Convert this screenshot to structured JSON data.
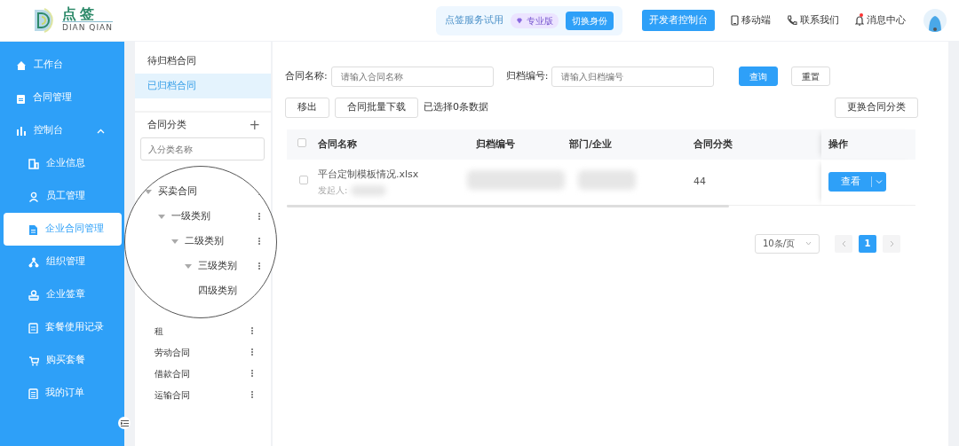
{
  "header": {
    "logo": {
      "title": "点签",
      "subtitle": "DIAN QIAN"
    },
    "trial": {
      "text": "点签服务试用",
      "edition": "专业版",
      "switch_button": "切换身份"
    },
    "dev_button": "开发者控制台",
    "links": [
      {
        "kind": "mobile",
        "label": "移动端"
      },
      {
        "kind": "phone",
        "label": "联系我们"
      },
      {
        "kind": "bell",
        "label": "消息中心",
        "unread": true
      }
    ]
  },
  "sidebar": {
    "items": [
      {
        "kind": "home",
        "label": "工作台",
        "selected": false
      },
      {
        "kind": "clipboard",
        "label": "合同管理",
        "selected": false
      },
      {
        "kind": "chart",
        "label": "控制台",
        "selected": false,
        "expanded": true,
        "children": [
          {
            "kind": "building",
            "label": "企业信息",
            "selected": false
          },
          {
            "kind": "user",
            "label": "员工管理",
            "selected": false
          },
          {
            "kind": "document",
            "label": "企业合同管理",
            "selected": true
          },
          {
            "kind": "org",
            "label": "组织管理",
            "selected": false
          },
          {
            "kind": "stamp",
            "label": "企业签章",
            "selected": false
          },
          {
            "kind": "record",
            "label": "套餐使用记录",
            "selected": false
          },
          {
            "kind": "cart",
            "label": "购买套餐",
            "selected": false
          },
          {
            "kind": "list",
            "label": "我的订单",
            "selected": false
          }
        ]
      }
    ]
  },
  "archive_tabs": [
    {
      "label": "待归档合同",
      "selected": false
    },
    {
      "label": "已归档合同",
      "selected": true
    }
  ],
  "categories": {
    "title": "合同分类",
    "add": "+",
    "search": {
      "placeholder": "入分类名称"
    },
    "tree": [
      {
        "label": "买卖合同",
        "expanded": true,
        "children": [
          {
            "label": "一级类别",
            "expanded": true,
            "children": [
              {
                "label": "二级类别",
                "expanded": true,
                "children": [
                  {
                    "label": "三级类别",
                    "expanded": true,
                    "children": [
                      {
                        "label": "四级类别"
                      }
                    ]
                  }
                ]
              }
            ]
          }
        ]
      },
      {
        "label": "租"
      },
      {
        "label": "劳动合同"
      },
      {
        "label": "借款合同"
      },
      {
        "label": "运输合同"
      }
    ]
  },
  "filters": [
    {
      "label": "合同名称:",
      "placeholder": "请输入合同名称"
    },
    {
      "label": "归档编号:",
      "placeholder": "请输入归档编号"
    }
  ],
  "filter_buttons": [
    {
      "label": "查询",
      "primary": true
    },
    {
      "label": "重置",
      "primary": false
    }
  ],
  "toolbar": {
    "buttons": [
      "移出",
      "合同批量下载"
    ],
    "selection": "已选择0条数据",
    "change_button": "更换合同分类"
  },
  "table": {
    "columns": [
      "合同名称",
      "归档编号",
      "部门/企业",
      "合同分类",
      "操作"
    ],
    "select_all": false,
    "rows": [
      {
        "checked": false,
        "name": "平台定制模板情况.xlsx",
        "initiator_label": "发起人:",
        "category": "44",
        "action": "查看"
      }
    ]
  },
  "pagination": {
    "page_size": "10条/页",
    "pages": [
      {
        "label": "1",
        "selected": true
      }
    ]
  }
}
